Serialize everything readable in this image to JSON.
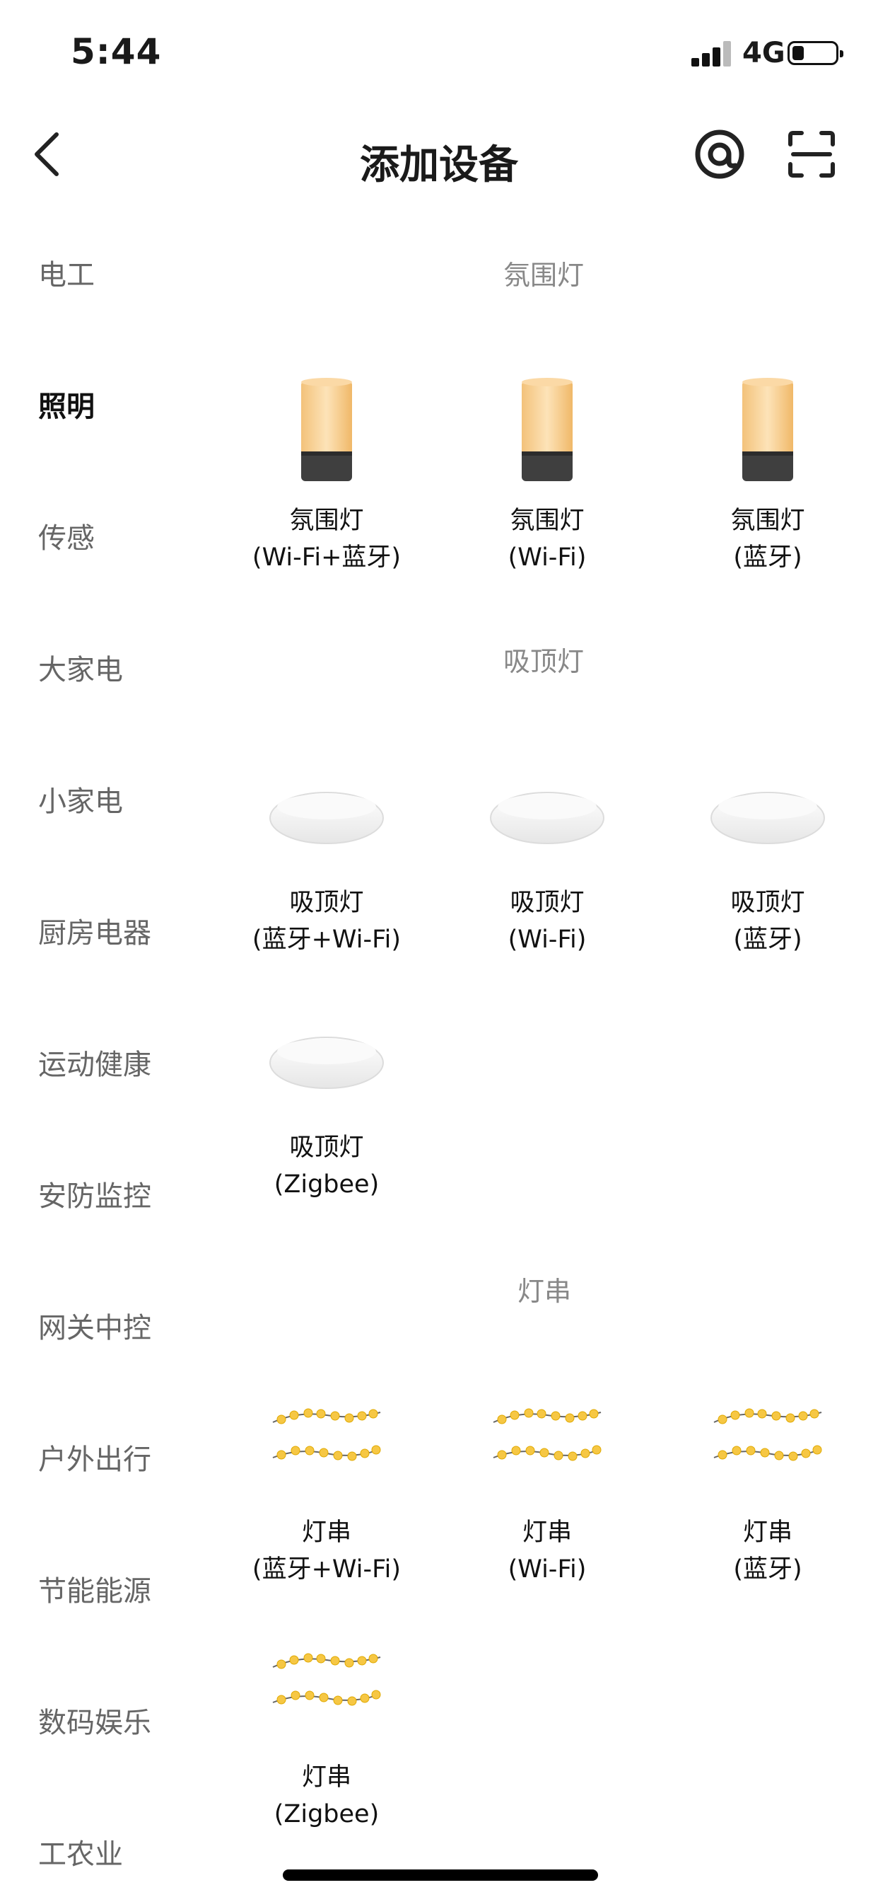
{
  "status_bar": {
    "time": "5:44",
    "network": "4G"
  },
  "header": {
    "title": "添加设备"
  },
  "sidebar": {
    "items": [
      {
        "label": "电工"
      },
      {
        "label": "照明"
      },
      {
        "label": "传感"
      },
      {
        "label": "大家电"
      },
      {
        "label": "小家电"
      },
      {
        "label": "厨房电器"
      },
      {
        "label": "运动健康"
      },
      {
        "label": "安防监控"
      },
      {
        "label": "网关中控"
      },
      {
        "label": "户外出行"
      },
      {
        "label": "节能能源"
      },
      {
        "label": "数码娱乐"
      },
      {
        "label": "工农业"
      }
    ],
    "active": "照明"
  },
  "sections": [
    {
      "title": "氛围灯",
      "devices": [
        {
          "line1": "氛围灯",
          "line2": "(Wi-Fi+蓝牙)",
          "icon": "ambient-lamp-icon"
        },
        {
          "line1": "氛围灯",
          "line2": "(Wi-Fi)",
          "icon": "ambient-lamp-icon"
        },
        {
          "line1": "氛围灯",
          "line2": "(蓝牙)",
          "icon": "ambient-lamp-icon"
        }
      ]
    },
    {
      "title": "吸顶灯",
      "devices": [
        {
          "line1": "吸顶灯",
          "line2": "(蓝牙+Wi-Fi)",
          "icon": "ceiling-light-icon"
        },
        {
          "line1": "吸顶灯",
          "line2": "(Wi-Fi)",
          "icon": "ceiling-light-icon"
        },
        {
          "line1": "吸顶灯",
          "line2": "(蓝牙)",
          "icon": "ceiling-light-icon"
        },
        {
          "line1": "吸顶灯",
          "line2": "(Zigbee)",
          "icon": "ceiling-light-icon"
        }
      ]
    },
    {
      "title": "灯串",
      "devices": [
        {
          "line1": "灯串",
          "line2": "(蓝牙+Wi-Fi)",
          "icon": "string-lights-icon"
        },
        {
          "line1": "灯串",
          "line2": "(Wi-Fi)",
          "icon": "string-lights-icon"
        },
        {
          "line1": "灯串",
          "line2": "(蓝牙)",
          "icon": "string-lights-icon"
        },
        {
          "line1": "灯串",
          "line2": "(Zigbee)",
          "icon": "string-lights-icon"
        }
      ]
    }
  ]
}
